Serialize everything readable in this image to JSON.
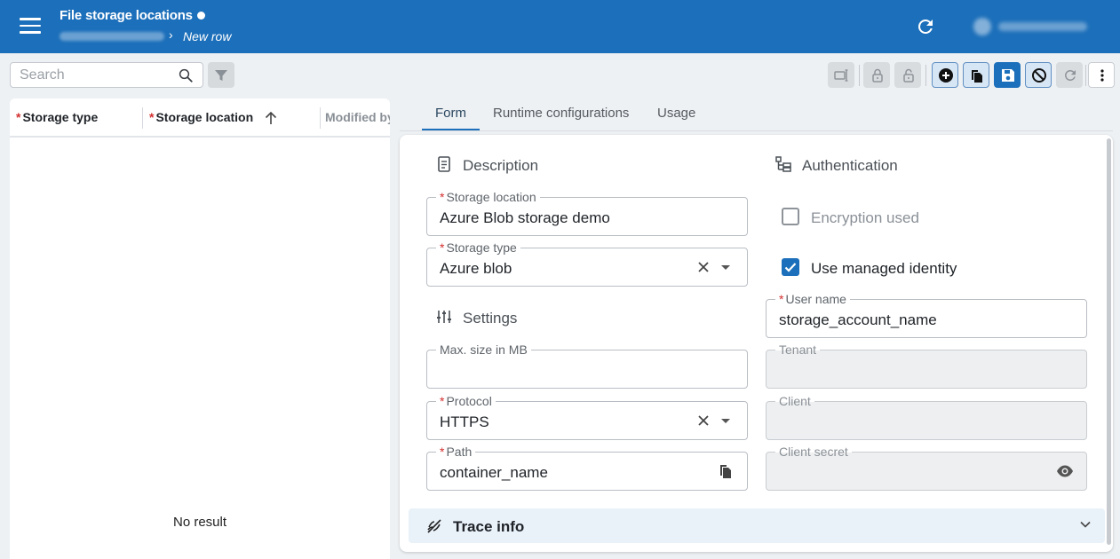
{
  "header": {
    "title": "File storage locations",
    "breadcrumb_current": "New row"
  },
  "toolbar": {
    "search_placeholder": "Search"
  },
  "grid": {
    "columns": [
      {
        "label": "Storage type",
        "required": true
      },
      {
        "label": "Storage location",
        "required": true,
        "sorted": "ascending"
      },
      {
        "label": "Modified by",
        "required": false
      }
    ],
    "empty_text": "No result"
  },
  "tabs": [
    {
      "label": "Form",
      "active": true
    },
    {
      "label": "Runtime configurations",
      "active": false
    },
    {
      "label": "Usage",
      "active": false
    }
  ],
  "form": {
    "description_title": "Description",
    "settings_title": "Settings",
    "authentication_title": "Authentication",
    "storage_location": {
      "label": "Storage location",
      "value": "Azure Blob storage demo",
      "required": true
    },
    "storage_type": {
      "label": "Storage type",
      "value": "Azure blob",
      "required": true
    },
    "max_size": {
      "label": "Max. size in MB",
      "value": ""
    },
    "protocol": {
      "label": "Protocol",
      "value": "HTTPS",
      "required": true
    },
    "path": {
      "label": "Path",
      "value": "container_name",
      "required": true
    },
    "encryption_used": {
      "label": "Encryption used",
      "checked": false
    },
    "use_managed_identity": {
      "label": "Use managed identity",
      "checked": true
    },
    "user_name": {
      "label": "User name",
      "value": "storage_account_name",
      "required": true
    },
    "tenant": {
      "label": "Tenant",
      "value": ""
    },
    "client": {
      "label": "Client",
      "value": ""
    },
    "client_secret": {
      "label": "Client secret",
      "value": ""
    },
    "trace_info_title": "Trace info"
  },
  "colors": {
    "primary": "#1c6fba",
    "required": "#d32f2f"
  },
  "icons": [
    "menu-icon",
    "refresh-icon",
    "search-icon",
    "filter-icon",
    "rename-icon",
    "lock-icon",
    "unlock-icon",
    "add-icon",
    "copy-icon",
    "save-icon",
    "cancel-icon",
    "reload-icon",
    "more-icon",
    "sort-up-icon",
    "document-icon",
    "settings-sliders-icon",
    "authentication-icon",
    "clear-icon",
    "chevron-down-icon",
    "eye-icon",
    "trace-icon"
  ]
}
